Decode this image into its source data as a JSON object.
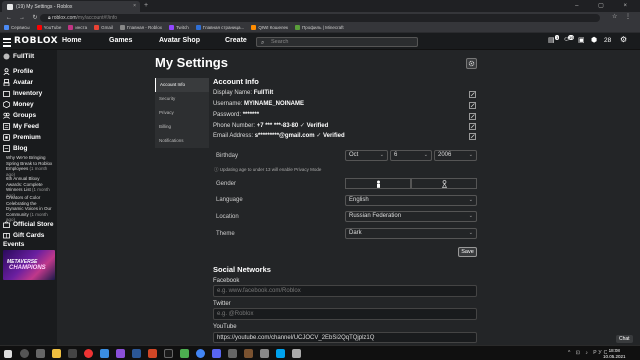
{
  "browser": {
    "tab_title": "(19) My Settings - Roblox",
    "tab_close": "×",
    "new_tab": "+",
    "window_controls": "–  ▢  ×",
    "url_host": "roblox.com",
    "url_path": "/my/account#!/info",
    "bookmarks": [
      {
        "label": "Сервисы",
        "color": "#4c8bf5"
      },
      {
        "label": "YouTube",
        "color": "#ff0000"
      },
      {
        "label": "инста",
        "color": "#c13584"
      },
      {
        "label": "Gmail",
        "color": "#ea4335"
      },
      {
        "label": "Главная - Roblox",
        "color": "#888888"
      },
      {
        "label": "Twitch",
        "color": "#9146ff"
      },
      {
        "label": "Главная страница...",
        "color": "#2f6fd6"
      },
      {
        "label": "QIWI Кошелек",
        "color": "#ff8c00"
      },
      {
        "label": "Профиль | Minecraft",
        "color": "#5a9e3a"
      }
    ]
  },
  "header": {
    "logo": "ROBLOX",
    "nav": [
      "Home",
      "Games",
      "Avatar Shop",
      "Create"
    ],
    "search_placeholder": "Search",
    "robux": "28",
    "notif_count": "19"
  },
  "sidebar": {
    "username": "FullTilt",
    "items": [
      "Profile",
      "Avatar",
      "Inventory",
      "Money",
      "Groups",
      "My Feed",
      "Premium",
      "Blog"
    ],
    "blog_posts": [
      {
        "title": "Why We're Bringing Spring Break to Roblox Employees",
        "date": "(1 month ago)"
      },
      {
        "title": "6th Annual Bloxy Awards: Complete Winners List",
        "date": "(1 month ago)"
      },
      {
        "title": "Creators of Color Celebrating the Dynamic Voices in Our Community",
        "date": "(1 month ago)"
      }
    ],
    "official_store": "Official Store",
    "gift_cards": "Gift Cards",
    "events": "Events",
    "event_line1": "METAVERSE",
    "event_line2": "CHAMPIONS"
  },
  "page": {
    "title": "My Settings",
    "menu": [
      "Account Info",
      "Security",
      "Privacy",
      "Billing",
      "Notifications"
    ],
    "account_info": {
      "heading": "Account Info",
      "display_name_label": "Display Name:",
      "display_name": "FullTilt",
      "username_label": "Username:",
      "username": "MYINAME_NOINAME",
      "password_label": "Password:",
      "password": "*******",
      "phone_label": "Phone Number:",
      "phone": "+7 *** ***-83-80",
      "email_label": "Email Address:",
      "email": "s*********@gmail.com",
      "verified": "Verified"
    },
    "birthday_label": "Birthday",
    "birthday_month": "Oct",
    "birthday_day": "6",
    "birthday_year": "2006",
    "birthday_note": "Updating age to under 13 will enable Privacy Mode",
    "gender_label": "Gender",
    "language_label": "Language",
    "language": "English",
    "location_label": "Location",
    "location": "Russian Federation",
    "theme_label": "Theme",
    "theme": "Dark",
    "save": "Save",
    "social": {
      "heading": "Social Networks",
      "facebook_label": "Facebook",
      "facebook_placeholder": "e.g. www.facebook.com/Roblox",
      "twitter_label": "Twitter",
      "twitter_placeholder": "e.g. @Roblox",
      "youtube_label": "YouTube",
      "youtube_value": "https://youtube.com/channel/UCJOCV_2EbSi2QqTQjplz1Q"
    },
    "chat": "Chat"
  },
  "taskbar": {
    "time": "18:08",
    "date": "10.05.2021",
    "tray": "^ ⊡ ♪ РУС"
  }
}
